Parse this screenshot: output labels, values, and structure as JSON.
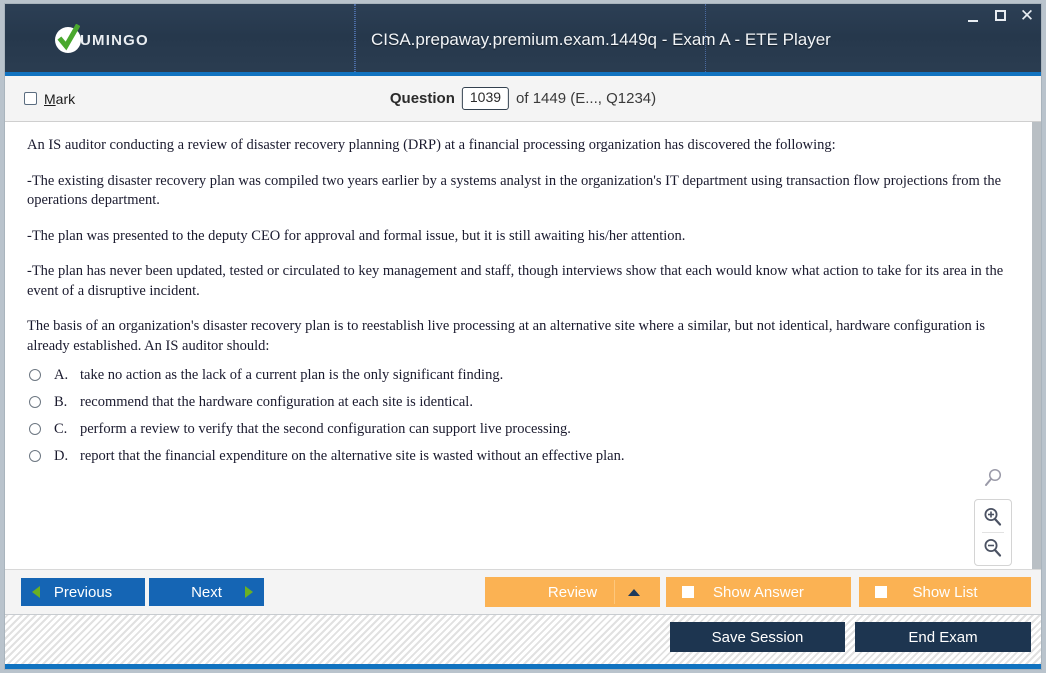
{
  "window": {
    "title": "CISA.prepaway.premium.exam.1449q - Exam A - ETE Player",
    "logo_text": "UMINGO",
    "controls": {
      "minimize": "minimize-icon",
      "maximize": "maximize-icon",
      "close": "✕"
    }
  },
  "question_header": {
    "mark_label_pre": "",
    "mark_label_key": "M",
    "mark_label_rest": "ark",
    "question_label": "Question",
    "question_number": "1039",
    "of_text": "of 1449 (E..., Q1234)"
  },
  "question": {
    "paragraphs": [
      "An IS auditor conducting a review of disaster recovery planning (DRP) at a financial processing organization has discovered the following:",
      "-The existing disaster recovery plan was compiled two years earlier by a systems analyst in the organization's IT department using transaction flow projections from the operations department.",
      "-The plan was presented to the deputy CEO for approval and formal issue, but it is still awaiting his/her attention.",
      "-The plan has never been updated, tested or circulated to key management and staff, though interviews show that each would know what action to take for its area in the event of a disruptive incident.",
      "The basis of an organization's disaster recovery plan is to reestablish live processing at an alternative site where a similar, but not identical, hardware configuration is already established. An IS auditor should:"
    ],
    "options": [
      {
        "letter": "A.",
        "text": "take no action as the lack of a current plan is the only significant finding."
      },
      {
        "letter": "B.",
        "text": "recommend that the hardware configuration at each site is identical."
      },
      {
        "letter": "C.",
        "text": "perform a review to verify that the second configuration can support live processing."
      },
      {
        "letter": "D.",
        "text": "report that the financial expenditure on the alternative site is wasted without an effective plan."
      }
    ]
  },
  "zoom_tools": {
    "magnifier": "magnifier-icon",
    "zoom_in": "zoom-in-icon",
    "zoom_out": "zoom-out-icon"
  },
  "action_bar": {
    "previous": "Previous",
    "next": "Next",
    "review": "Review",
    "show_answer": "Show Answer",
    "show_list": "Show List"
  },
  "status_bar": {
    "save_session": "Save Session",
    "end_exam": "End Exam"
  },
  "colors": {
    "titlebar": "#2b3d51",
    "accent_blue": "#1173c0",
    "button_blue": "#1565b4",
    "button_orange": "#fbb253",
    "button_navy": "#1d3550",
    "chevron_green": "#6ab023",
    "logo_check_green": "#4aa82e"
  }
}
